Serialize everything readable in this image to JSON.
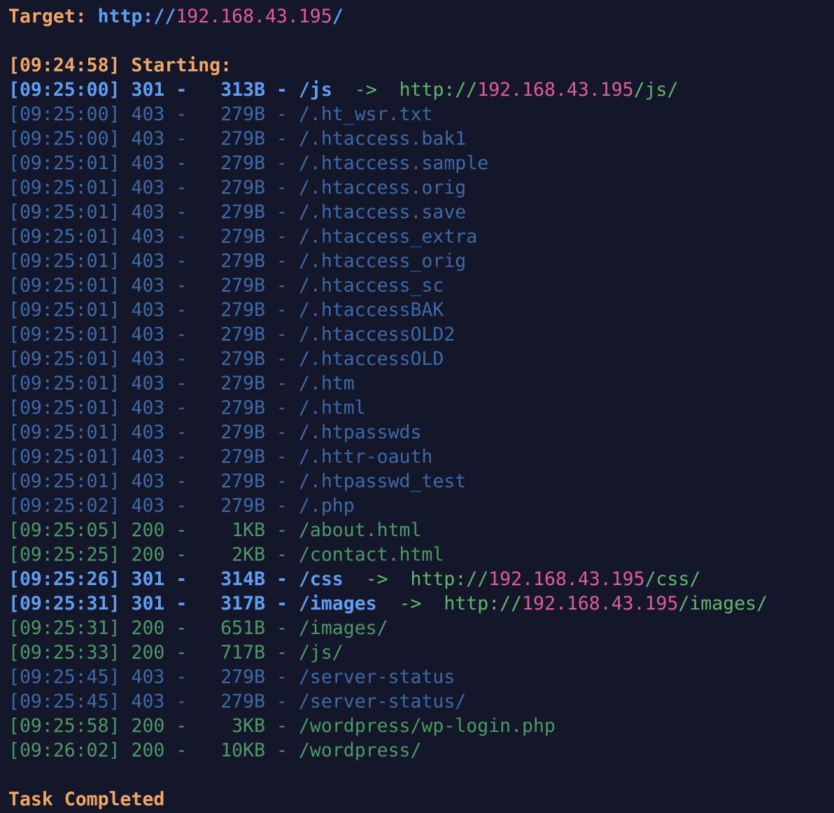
{
  "header": {
    "target_label": "Target:",
    "target_scheme": "http://",
    "target_host": "192.168.43.195",
    "target_slash": "/"
  },
  "start": {
    "timestamp": "[09:24:58]",
    "label": "Starting:"
  },
  "rows": [
    {
      "ts": "[09:25:00]",
      "status": "301",
      "size": "313B",
      "path": "/js",
      "redirect": {
        "scheme": "http://",
        "host": "192.168.43.195",
        "path": "/js/"
      },
      "style": "redirect"
    },
    {
      "ts": "[09:25:00]",
      "status": "403",
      "size": "279B",
      "path": "/.ht_wsr.txt",
      "style": "forbidden"
    },
    {
      "ts": "[09:25:00]",
      "status": "403",
      "size": "279B",
      "path": "/.htaccess.bak1",
      "style": "forbidden"
    },
    {
      "ts": "[09:25:01]",
      "status": "403",
      "size": "279B",
      "path": "/.htaccess.sample",
      "style": "forbidden"
    },
    {
      "ts": "[09:25:01]",
      "status": "403",
      "size": "279B",
      "path": "/.htaccess.orig",
      "style": "forbidden"
    },
    {
      "ts": "[09:25:01]",
      "status": "403",
      "size": "279B",
      "path": "/.htaccess.save",
      "style": "forbidden"
    },
    {
      "ts": "[09:25:01]",
      "status": "403",
      "size": "279B",
      "path": "/.htaccess_extra",
      "style": "forbidden"
    },
    {
      "ts": "[09:25:01]",
      "status": "403",
      "size": "279B",
      "path": "/.htaccess_orig",
      "style": "forbidden"
    },
    {
      "ts": "[09:25:01]",
      "status": "403",
      "size": "279B",
      "path": "/.htaccess_sc",
      "style": "forbidden"
    },
    {
      "ts": "[09:25:01]",
      "status": "403",
      "size": "279B",
      "path": "/.htaccessBAK",
      "style": "forbidden"
    },
    {
      "ts": "[09:25:01]",
      "status": "403",
      "size": "279B",
      "path": "/.htaccessOLD2",
      "style": "forbidden"
    },
    {
      "ts": "[09:25:01]",
      "status": "403",
      "size": "279B",
      "path": "/.htaccessOLD",
      "style": "forbidden"
    },
    {
      "ts": "[09:25:01]",
      "status": "403",
      "size": "279B",
      "path": "/.htm",
      "style": "forbidden"
    },
    {
      "ts": "[09:25:01]",
      "status": "403",
      "size": "279B",
      "path": "/.html",
      "style": "forbidden"
    },
    {
      "ts": "[09:25:01]",
      "status": "403",
      "size": "279B",
      "path": "/.htpasswds",
      "style": "forbidden"
    },
    {
      "ts": "[09:25:01]",
      "status": "403",
      "size": "279B",
      "path": "/.httr-oauth",
      "style": "forbidden"
    },
    {
      "ts": "[09:25:01]",
      "status": "403",
      "size": "279B",
      "path": "/.htpasswd_test",
      "style": "forbidden"
    },
    {
      "ts": "[09:25:02]",
      "status": "403",
      "size": "279B",
      "path": "/.php",
      "style": "forbidden"
    },
    {
      "ts": "[09:25:05]",
      "status": "200",
      "size": "1KB",
      "path": "/about.html",
      "style": "ok"
    },
    {
      "ts": "[09:25:25]",
      "status": "200",
      "size": "2KB",
      "path": "/contact.html",
      "style": "ok"
    },
    {
      "ts": "[09:25:26]",
      "status": "301",
      "size": "314B",
      "path": "/css",
      "redirect": {
        "scheme": "http://",
        "host": "192.168.43.195",
        "path": "/css/"
      },
      "style": "redirect"
    },
    {
      "ts": "[09:25:31]",
      "status": "301",
      "size": "317B",
      "path": "/images",
      "redirect": {
        "scheme": "http://",
        "host": "192.168.43.195",
        "path": "/images/"
      },
      "style": "redirect"
    },
    {
      "ts": "[09:25:31]",
      "status": "200",
      "size": "651B",
      "path": "/images/",
      "style": "ok"
    },
    {
      "ts": "[09:25:33]",
      "status": "200",
      "size": "717B",
      "path": "/js/",
      "style": "ok"
    },
    {
      "ts": "[09:25:45]",
      "status": "403",
      "size": "279B",
      "path": "/server-status",
      "style": "forbidden"
    },
    {
      "ts": "[09:25:45]",
      "status": "403",
      "size": "279B",
      "path": "/server-status/",
      "style": "forbidden"
    },
    {
      "ts": "[09:25:58]",
      "status": "200",
      "size": "3KB",
      "path": "/wordpress/wp-login.php",
      "style": "ok"
    },
    {
      "ts": "[09:26:02]",
      "status": "200",
      "size": "10KB",
      "path": "/wordpress/",
      "style": "ok"
    }
  ],
  "separator": "-",
  "arrow": "->",
  "footer": {
    "label": "Task Completed"
  },
  "colors": {
    "background": "#141729",
    "orange": "#f0a860",
    "blue": "#5d9ff2",
    "pink": "#e25a9a",
    "green": "#5fb868",
    "dim_blue": "#3a6aa8",
    "dim_green": "#4a9a64"
  }
}
